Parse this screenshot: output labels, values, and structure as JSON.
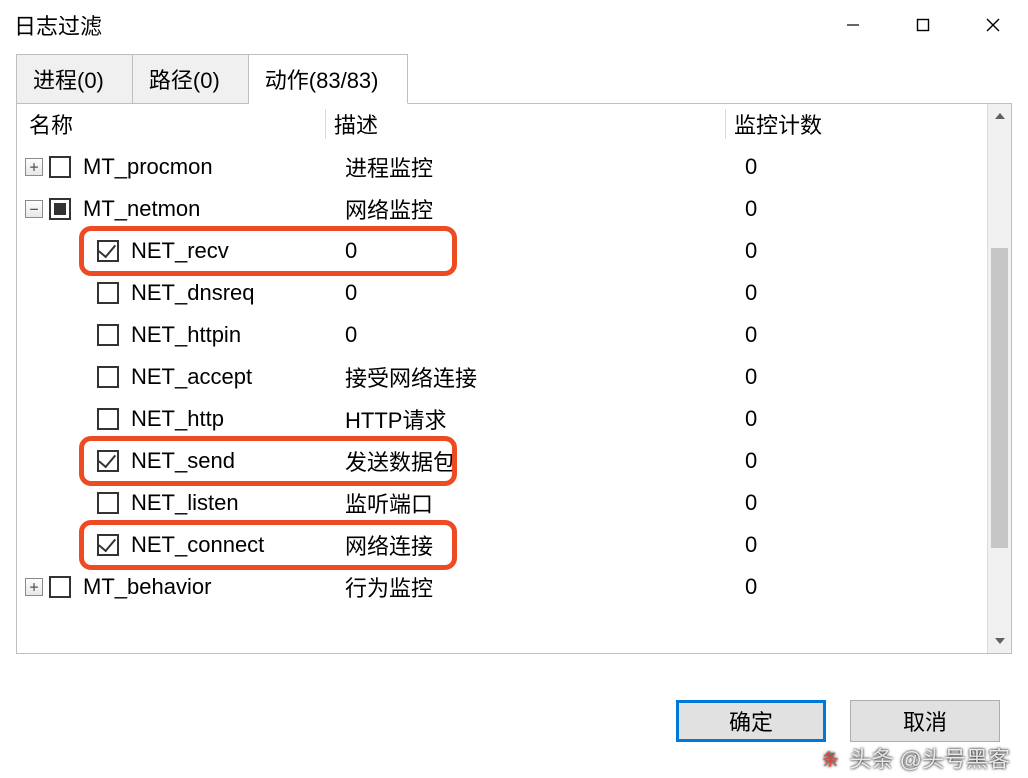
{
  "window": {
    "title": "日志过滤"
  },
  "tabs": [
    {
      "label": "进程(0)",
      "active": false
    },
    {
      "label": "路径(0)",
      "active": false
    },
    {
      "label": "动作(83/83)",
      "active": true
    }
  ],
  "columns": {
    "name": "名称",
    "desc": "描述",
    "count": "监控计数"
  },
  "tree": [
    {
      "level": 0,
      "expander": "plus",
      "check": "unchecked",
      "name": "MT_procmon",
      "desc": "进程监控",
      "count": "0",
      "hl": false
    },
    {
      "level": 0,
      "expander": "minus",
      "check": "indeterminate",
      "name": "MT_netmon",
      "desc": "网络监控",
      "count": "0",
      "hl": false
    },
    {
      "level": 1,
      "expander": null,
      "check": "checked",
      "name": "NET_recv",
      "desc": "0",
      "count": "0",
      "hl": true
    },
    {
      "level": 1,
      "expander": null,
      "check": "unchecked",
      "name": "NET_dnsreq",
      "desc": "0",
      "count": "0",
      "hl": false
    },
    {
      "level": 1,
      "expander": null,
      "check": "unchecked",
      "name": "NET_httpin",
      "desc": "0",
      "count": "0",
      "hl": false
    },
    {
      "level": 1,
      "expander": null,
      "check": "unchecked",
      "name": "NET_accept",
      "desc": "接受网络连接",
      "count": "0",
      "hl": false
    },
    {
      "level": 1,
      "expander": null,
      "check": "unchecked",
      "name": "NET_http",
      "desc": "HTTP请求",
      "count": "0",
      "hl": false
    },
    {
      "level": 1,
      "expander": null,
      "check": "checked",
      "name": "NET_send",
      "desc": "发送数据包",
      "count": "0",
      "hl": true
    },
    {
      "level": 1,
      "expander": null,
      "check": "unchecked",
      "name": "NET_listen",
      "desc": "监听端口",
      "count": "0",
      "hl": false
    },
    {
      "level": 1,
      "expander": null,
      "check": "checked",
      "name": "NET_connect",
      "desc": "网络连接",
      "count": "0",
      "hl": true
    },
    {
      "level": 0,
      "expander": "plus",
      "check": "unchecked",
      "name": "MT_behavior",
      "desc": "行为监控",
      "count": "0",
      "hl": false
    }
  ],
  "buttons": {
    "ok": "确定",
    "cancel": "取消"
  },
  "watermark": "头条 @头号黑客"
}
